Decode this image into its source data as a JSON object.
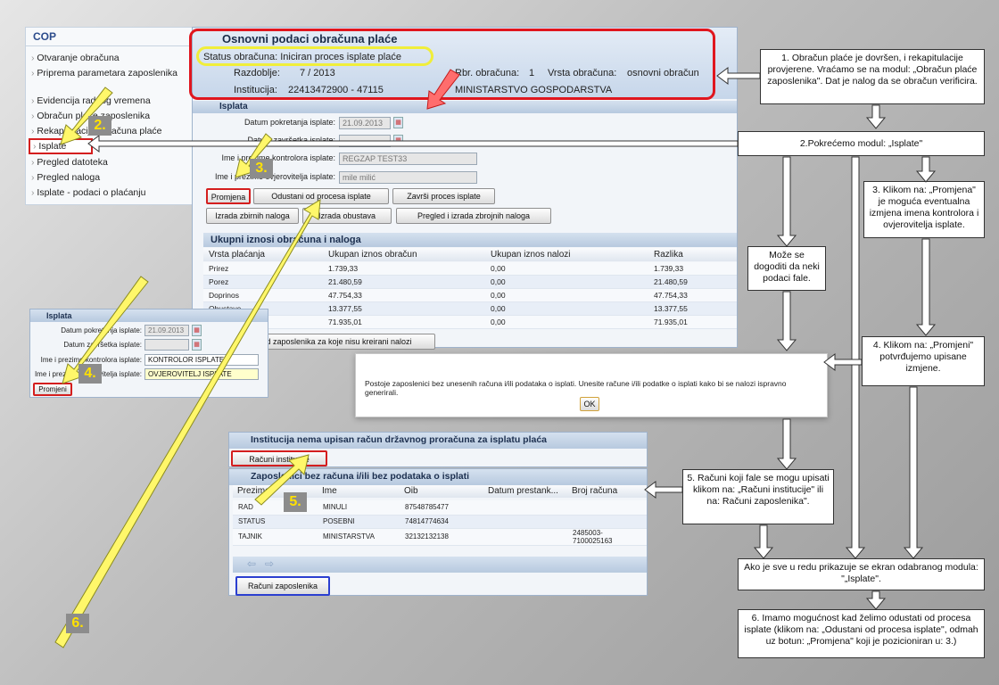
{
  "sidebar": {
    "title": "COP",
    "items": [
      {
        "label": "Otvaranje obračuna"
      },
      {
        "label": "Priprema parametara zaposlenika"
      },
      {
        "label": "Evidencija radnog vremena"
      },
      {
        "label": "Obračun plaće zaposlenika"
      },
      {
        "label": "Rekapitulacija obračuna plaće"
      },
      {
        "label": "Isplate"
      },
      {
        "label": "Pregled datoteka"
      },
      {
        "label": "Pregled naloga"
      },
      {
        "label": "Isplate - podaci o plaćanju"
      }
    ]
  },
  "header": {
    "title": "Osnovni podaci obračuna plaće",
    "status": "Status obračuna: Iniciran proces isplate plaće",
    "razdoblje_label": "Razdoblje:",
    "razdoblje_value": "7 / 2013",
    "rbr_label": "Rbr. obračuna:",
    "rbr_value": "1",
    "vrsta_label": "Vrsta obračuna:",
    "vrsta_value": "osnovni obračun",
    "institucija_label": "Institucija:",
    "institucija_value": "22413472900 - 47115",
    "ministarstvo": "MINISTARSTVO GOSPODARSTVA"
  },
  "isplata": {
    "title": "Isplata",
    "datum_pokretanja_label": "Datum pokretanja isplate:",
    "datum_pokretanja_value": "21.09.2013",
    "datum_zavrsetka_label": "Datum završetka isplate:",
    "kontrolor_label": "Ime i prezime kontrolora isplate:",
    "kontrolor_value": "REGZAP TEST33",
    "ovjerovitelj_label": "Ime i prezime ovjerovitelja isplate:",
    "ovjerovitelj_value": "mile milić",
    "btn_promjena": "Promjena",
    "btn_odustani": "Odustani od procesa isplate",
    "btn_zavrsi": "Završi proces isplate",
    "btn_zbirni": "Izrada zbirnih naloga",
    "btn_obustava": "Izrada obustava",
    "btn_pregled": "Pregled i izrada zbrojnih naloga"
  },
  "ukupni": {
    "title": "Ukupni iznosi obračuna i naloga",
    "headers": [
      "Vrsta plaćanja",
      "Ukupan iznos obračun",
      "Ukupan iznos nalozi",
      "Razlika"
    ],
    "rows": [
      [
        "Prirez",
        "1.739,33",
        "0,00",
        "1.739,33"
      ],
      [
        "Porez",
        "21.480,59",
        "0,00",
        "21.480,59"
      ],
      [
        "Doprinos",
        "47.754,33",
        "0,00",
        "47.754,33"
      ],
      [
        "Obustave",
        "13.377,55",
        "0,00",
        "13.377,55"
      ],
      [
        "Neto iznosi",
        "71.935,01",
        "0,00",
        "71.935,01"
      ]
    ],
    "btn_pregled_zaposlenika": "Pregled zaposlenika za koje nisu kreirani nalozi"
  },
  "small_isplata": {
    "title": "Isplata",
    "datum_pokretanja_label": "Datum pokretanja isplate:",
    "datum_pokretanja_value": "21.09.2013",
    "datum_zavrsetka_label": "Datum završetka isplate:",
    "kontrolor_label": "Ime i prezime kontrolora isplate:",
    "kontrolor_value": "KONTROLOR ISPLATE",
    "ovjerovitelj_label": "Ime i prezime ovjerovitelja isplate:",
    "ovjerovitelj_value": "OVJEROVITELJ ISPLATE",
    "btn_promjeni": "Promjeni"
  },
  "dialog": {
    "message": "Postoje zaposlenici bez unesenih računa i/ili podataka o isplati. Unesite račune i/ili podatke o isplati kako bi se nalozi ispravno generirali.",
    "ok": "OK"
  },
  "institucija_panel": {
    "title": "Institucija nema upisan račun državnog proračuna za isplatu plaća",
    "btn": "Računi institucije"
  },
  "zaposlenici_panel": {
    "title": "Zaposlenici bez računa i/ili bez podataka o isplati",
    "headers": [
      "Prezime",
      "Ime",
      "Oib",
      "Datum prestank...",
      "Broj računa"
    ],
    "rows": [
      [
        "RAD",
        "MINULI",
        "87548785477",
        "",
        ""
      ],
      [
        "STATUS",
        "POSEBNI",
        "74814774634",
        "",
        ""
      ],
      [
        "TAJNIK",
        "MINISTARSTVA",
        "32132132138",
        "",
        "2485003-7100025163"
      ]
    ],
    "btn": "Računi zaposlenika"
  },
  "notes": {
    "n1": "1. Obračun plaće je dovršen, i rekapitulacije provjerene. Vraćamo se na modul: „Obračun plaće zaposlenika\". Dat je nalog da se obračun verificira.",
    "n2": "2.Pokrećemo modul: „Isplate\"",
    "n3": "3. Klikom na: „Promjena\" je moguća eventualna izmjena imena kontrolora i ovjerovitelja isplate.",
    "n_moze": "Može se dogoditi da neki podaci fale.",
    "n4": "4. Klikom na: „Promjeni\" potvrđujemo upisane izmjene.",
    "n5": "5. Računi koji fale se mogu upisati klikom na: „Računi institucije\" ili na: Računi zaposlenika\".",
    "n_ako": "Ako je sve u redu prikazuje se ekran odabranog modula: \"„Isplate\".",
    "n6": "6. Imamo mogućnost kad želimo odustati od procesa isplate (klikom na: „Odustani od procesa isplate\", odmah uz botun: „Promjena\" koji je pozicioniran u: 3.)"
  },
  "badges": {
    "b2": "2.",
    "b3": "3.",
    "b4": "4.",
    "b5": "5.",
    "b6": "6."
  }
}
